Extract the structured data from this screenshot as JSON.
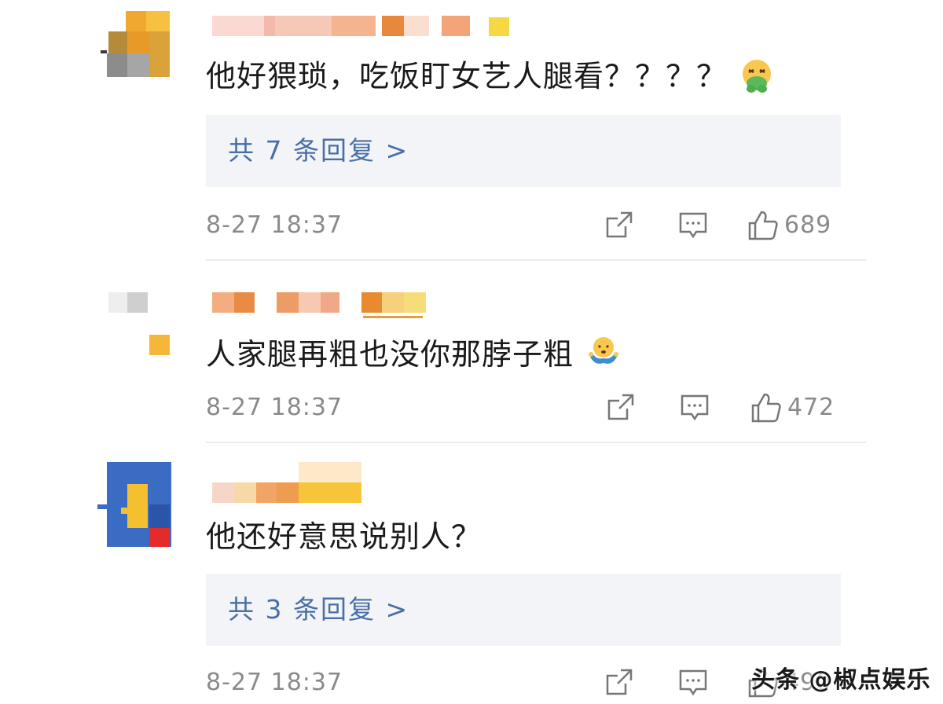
{
  "comments": [
    {
      "text": "他好猥琐，吃饭盯女艺人腿看？？？？",
      "emoji": "nauseated-face-emoji",
      "replies_label": "共 7 条回复 >",
      "time": "8-27 18:37",
      "likes": "689"
    },
    {
      "text": "人家腿再粗也没你那脖子粗",
      "emoji": "shrugging-emoji",
      "time": "8-27 18:37",
      "likes": "472"
    },
    {
      "text": "他还好意思说别人？",
      "replies_label": "共 3 条回复 >",
      "time": "8-27 18:37",
      "likes": "490"
    }
  ],
  "icons": {
    "share": "share-icon",
    "comment": "comment-icon",
    "like": "thumbs-up-icon"
  },
  "watermark": "头条 @椒点娱乐",
  "colors": {
    "reply_link": "#4a6fa5",
    "reply_bg": "#f2f4f8",
    "meta_text": "#8a8a8a",
    "divider": "#ececec"
  }
}
